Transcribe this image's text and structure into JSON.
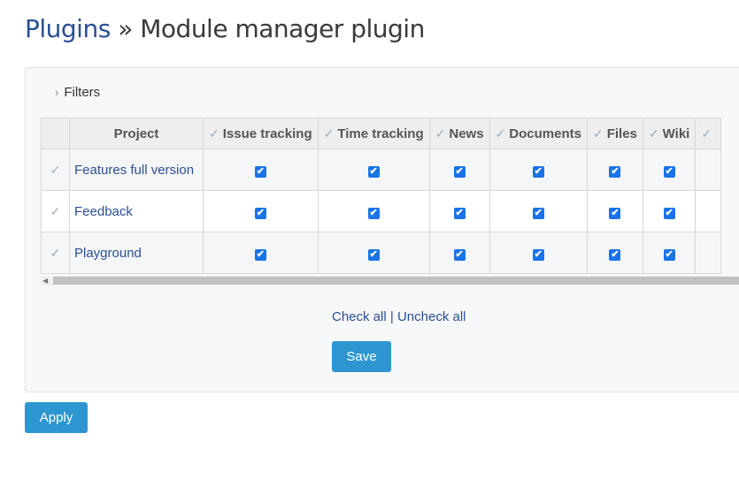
{
  "header": {
    "breadcrumb_link": "Plugins",
    "separator": "»",
    "title": "Module manager plugin"
  },
  "filters": {
    "label": "Filters",
    "icon": "chevron-right-icon"
  },
  "table": {
    "columns": [
      "Project",
      "Issue tracking",
      "Time tracking",
      "News",
      "Documents",
      "Files",
      "Wiki",
      ""
    ],
    "rows": [
      {
        "project": "Features full version",
        "checked": [
          true,
          true,
          true,
          true,
          true,
          true
        ]
      },
      {
        "project": "Feedback",
        "checked": [
          true,
          true,
          true,
          true,
          true,
          true
        ]
      },
      {
        "project": "Playground",
        "checked": [
          true,
          true,
          true,
          true,
          true,
          true
        ]
      }
    ]
  },
  "actions": {
    "check_all": "Check all",
    "divider": "|",
    "uncheck_all": "Uncheck all",
    "save": "Save"
  },
  "apply": "Apply",
  "colors": {
    "accent": "#2d96d1",
    "link": "#2b4f94",
    "checkbox": "#1a73e8"
  }
}
